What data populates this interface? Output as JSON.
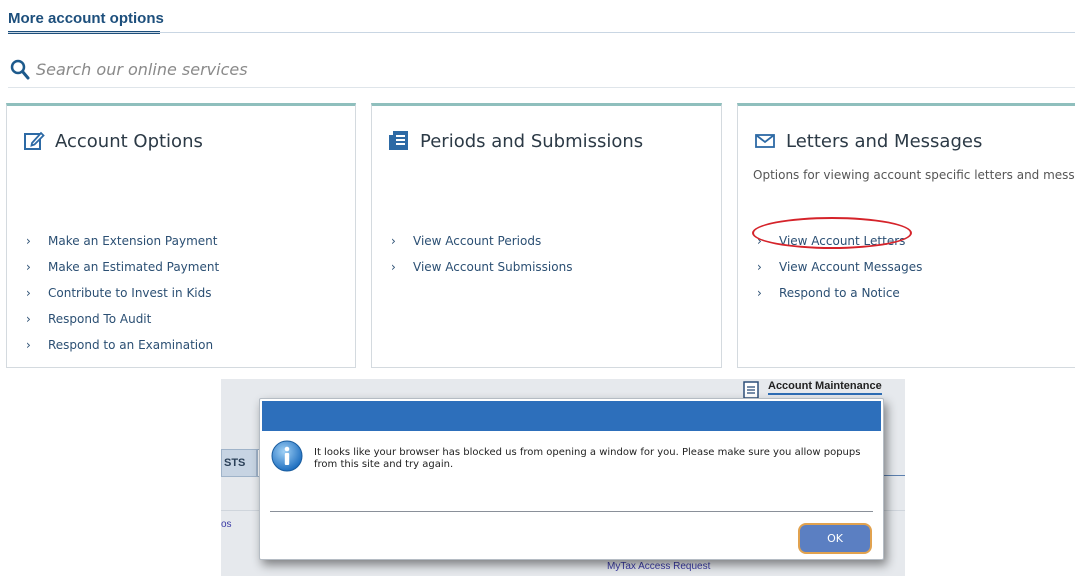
{
  "header": {
    "tab_label": "More account options"
  },
  "search": {
    "placeholder": "Search our online services",
    "value": ""
  },
  "cards": [
    {
      "title": "Account Options",
      "icon": "edit-icon",
      "description": "",
      "links": [
        "Make an Extension Payment",
        "Make an Estimated Payment",
        "Contribute to Invest in Kids",
        "Respond To Audit",
        "Respond to an Examination"
      ]
    },
    {
      "title": "Periods and Submissions",
      "icon": "document-list-icon",
      "description": "",
      "links": [
        "View Account Periods",
        "View Account Submissions"
      ]
    },
    {
      "title": "Letters and Messages",
      "icon": "envelope-icon",
      "description": "Options for viewing account specific letters and messages.",
      "links": [
        "View Account Letters",
        "View Account Messages",
        "Respond to a Notice"
      ]
    }
  ],
  "background_panel": {
    "account_maintenance": "Account Maintenance",
    "tab_fragment": "STS",
    "link_fragment": "os",
    "mytax_link": "MyTax Access Request"
  },
  "dialog": {
    "message": "It looks like your browser has blocked us from opening a window for you.  Please make sure you allow popups from this site and try again.",
    "ok_label": "OK"
  },
  "colors": {
    "brand_blue": "#1d4f7c",
    "card_accent": "#8fbfbd",
    "dialog_titlebar": "#2d6fbb",
    "highlight_red": "#d5232a",
    "ok_button": "#5b7fc2"
  }
}
